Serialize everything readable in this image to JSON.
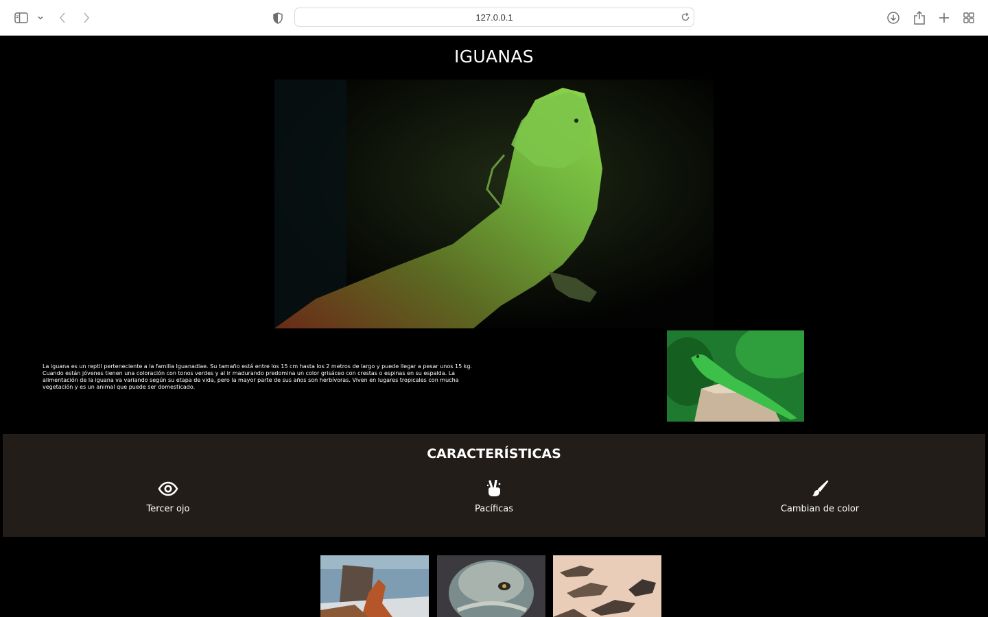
{
  "browser": {
    "url": "127.0.0.1",
    "icons": [
      "sidebar-icon",
      "chevron-down-icon",
      "back-icon",
      "forward-icon",
      "privacy-shield-icon",
      "reload-icon",
      "download-icon",
      "share-icon",
      "new-tab-icon",
      "tab-overview-icon"
    ]
  },
  "page": {
    "title": "IGUANAS",
    "intro": "La iguana es un reptil perteneciente a la familia Iguanadiae. Su tamaño está entre los 15 cm hasta los 2 metros de largo y puede llegar a pesar unos 15 kg. Cuando están jóvenes tienen una coloración con tonos verdes y al ir madurando predomina un color grisáceo con crestas o espinas en su espalda. La alimentación de la iguana va variando según su etapa de vida, pero la mayor parte de sus años son herbívoras. Viven en lugares tropicales con mucha vegetación y es un animal que puede ser domesticado.",
    "features": {
      "title": "CARACTERÍSTICAS",
      "items": [
        {
          "label": "Tercer ojo",
          "icon": "eye-icon"
        },
        {
          "label": "Pacíficas",
          "icon": "peace-hand-icon"
        },
        {
          "label": "Cambian de color",
          "icon": "paintbrush-icon"
        }
      ]
    }
  },
  "colors": {
    "page_bg": "#000000",
    "features_bg": "#221d18",
    "text": "#ffffff"
  }
}
